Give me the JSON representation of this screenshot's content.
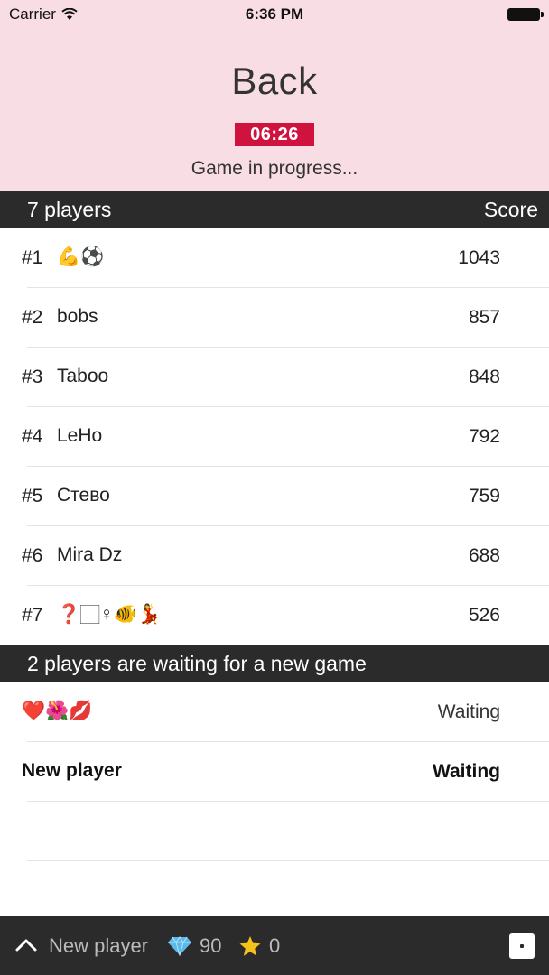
{
  "status_bar": {
    "carrier": "Carrier",
    "time": "6:36 PM"
  },
  "header": {
    "back_label": "Back",
    "timer": "06:26",
    "game_status": "Game in progress..."
  },
  "players_section": {
    "count_label": "7 players",
    "score_label": "Score"
  },
  "players": [
    {
      "rank": "#1",
      "name": "💪⚽",
      "score": "1043"
    },
    {
      "rank": "#2",
      "name": "bobs",
      "score": "857"
    },
    {
      "rank": "#3",
      "name": "Taboo",
      "score": "848"
    },
    {
      "rank": "#4",
      "name": "LeHo",
      "score": "792"
    },
    {
      "rank": "#5",
      "name": "Стево",
      "score": "759"
    },
    {
      "rank": "#6",
      "name": "Mira Dz",
      "score": "688"
    },
    {
      "rank": "#7",
      "name": "❓🏻♀🐠💃",
      "score": "526"
    }
  ],
  "waiting_section": {
    "label": "2 players are waiting for a new game"
  },
  "waiting_players": [
    {
      "name": "❤️🌺💋",
      "status": "Waiting"
    },
    {
      "name": "New player",
      "status": "Waiting"
    }
  ],
  "toolbar": {
    "player_name": "New player",
    "gems": "90",
    "stars": "0",
    "gem_icon": "diamond-icon",
    "star_icon": "star-icon",
    "gem_color": "#5bb8ea",
    "star_color": "#f4c21b"
  },
  "colors": {
    "header_bg": "#f8dde4",
    "timer_bg": "#d0123f",
    "bar_bg": "#2b2b2b"
  }
}
